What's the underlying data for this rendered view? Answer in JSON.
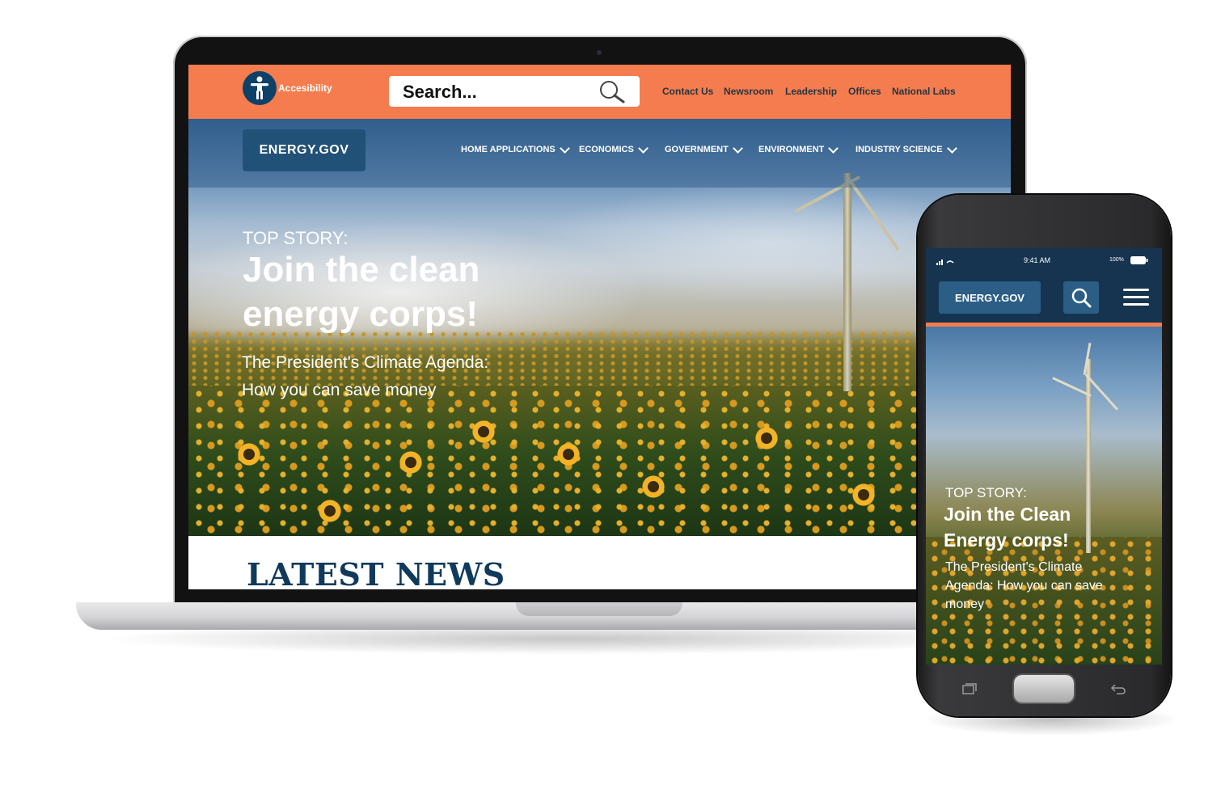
{
  "desktop": {
    "accessibility_label": "Accesibility",
    "search_placeholder": "Search...",
    "top_links": [
      "Contact Us",
      "Newsroom",
      "Leadership",
      "Offices",
      "National Labs"
    ],
    "logo": "ENERGY.GOV",
    "nav": [
      "HOME APPLICATIONS",
      "ECONOMICS",
      "GOVERNMENT",
      "ENVIRONMENT",
      "INDUSTRY SCIENCE"
    ],
    "hero": {
      "kicker": "TOP STORY:",
      "title": "Join the clean energy corps!",
      "subtitle": "The President's Climate Agenda: How you can save money"
    },
    "latest_news": "LATEST NEWS"
  },
  "mobile": {
    "status_time": "9:41 AM",
    "status_battery": "100%",
    "logo": "ENERGY.GOV",
    "hero": {
      "kicker": "TOP STORY:",
      "title": "Join the Clean Energy corps!",
      "subtitle": "The President's Climate Agenda: How you can save money"
    }
  },
  "colors": {
    "accent_orange": "#f57c4e",
    "navy": "#0e4168",
    "logo_blue": "#225177",
    "headline_blue": "#0f3a5c"
  },
  "icons": [
    "accessibility-icon",
    "search-icon",
    "chevron-down-icon",
    "menu-icon",
    "chat-icon",
    "signal-icon",
    "wifi-icon",
    "battery-icon",
    "recent-apps-icon",
    "back-icon"
  ]
}
